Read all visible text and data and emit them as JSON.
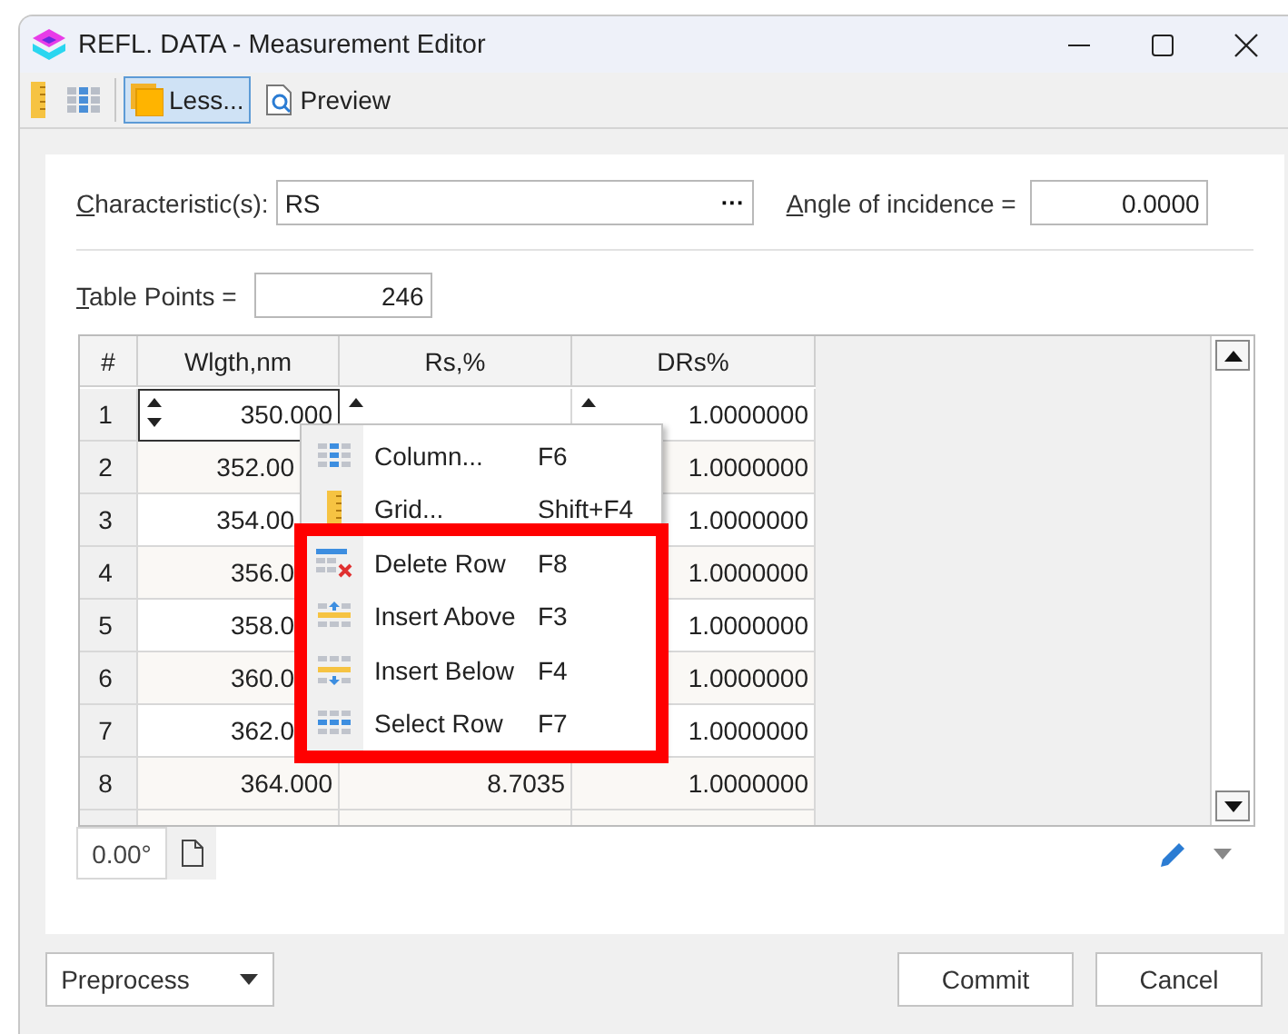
{
  "window": {
    "title": "REFL. DATA - Measurement Editor"
  },
  "toolbar": [
    {
      "kind": "icon",
      "selected": false
    },
    {
      "kind": "icon",
      "selected": false
    },
    {
      "kind": "labeled",
      "label": "Less...",
      "selected": true
    },
    {
      "kind": "labeled",
      "label": "Preview",
      "selected": false
    }
  ],
  "form": {
    "characteristic": {
      "label": "Characteristic(s):",
      "value": "RS",
      "button": "···"
    },
    "angle": {
      "label": "Angle of incidence =",
      "value": "0.0000"
    },
    "table_points": {
      "label": "Table Points =",
      "value": "246"
    }
  },
  "table": {
    "columns": [
      "#",
      "Wlgth,nm",
      "Rs,%",
      "DRs%"
    ],
    "rows": [
      {
        "num": "1",
        "wavelength": "350.000",
        "drs": "1.0000000",
        "editing": true
      },
      {
        "num": "2",
        "wavelength": "352.00",
        "drs": "1.0000000",
        "editing": false
      },
      {
        "num": "3",
        "wavelength": "354.00",
        "drs": "1.0000000",
        "editing": false
      },
      {
        "num": "4",
        "wavelength": "356.0",
        "drs": "1.0000000",
        "editing": false
      },
      {
        "num": "5",
        "wavelength": "358.0",
        "drs": "1.0000000",
        "editing": false
      },
      {
        "num": "6",
        "wavelength": "360.0",
        "drs": "1.0000000",
        "editing": false
      },
      {
        "num": "7",
        "wavelength": "362.0",
        "drs": "1.0000000",
        "editing": false
      },
      {
        "num": "8",
        "wavelength": "364.000",
        "rs": "8.7035",
        "drs": "1.0000000",
        "editing": false
      }
    ]
  },
  "context_menu": {
    "items": [
      {
        "label": "Column...",
        "shortcut": "F6",
        "highlighted": false
      },
      {
        "label": "Grid...",
        "shortcut": "Shift+F4",
        "highlighted": false
      },
      {
        "label": "Delete Row",
        "shortcut": "F8",
        "highlighted": true
      },
      {
        "label": "Insert Above",
        "shortcut": "F3",
        "highlighted": true
      },
      {
        "label": "Insert Below",
        "shortcut": "F4",
        "highlighted": true
      },
      {
        "label": "Select Row",
        "shortcut": "F7",
        "highlighted": true
      }
    ]
  },
  "angle_readout": "0.00°",
  "buttons": [
    {
      "label": "Preprocess",
      "kind": "dropdown"
    },
    {
      "label": "Commit",
      "kind": "plain"
    },
    {
      "label": "Cancel",
      "kind": "plain"
    }
  ]
}
